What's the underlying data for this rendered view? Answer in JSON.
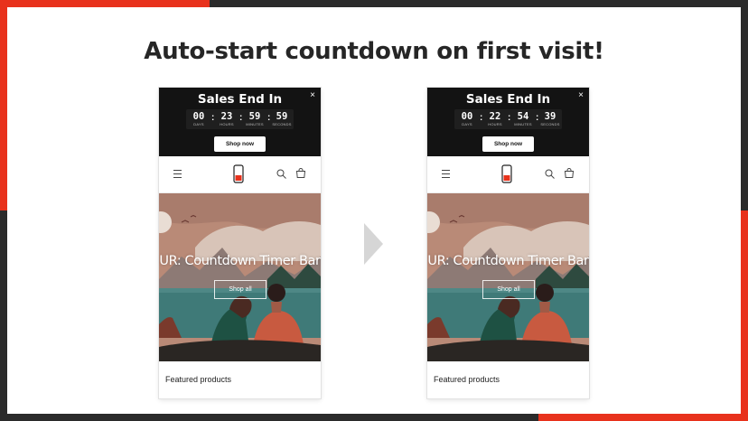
{
  "headline": "Auto-start countdown on first visit!",
  "phones": [
    {
      "announcement": {
        "title": "Sales End In",
        "close": "×",
        "timer": {
          "days": "00",
          "hours": "23",
          "minutes": "59",
          "seconds": "59",
          "days_label": "DAYS",
          "hours_label": "HOURS",
          "minutes_label": "MINUTES",
          "seconds_label": "SECONDS",
          "separator": ":"
        },
        "button": "Shop now"
      },
      "hero": {
        "heading": "UR: Countdown Timer Bar",
        "button": "Shop all"
      },
      "featured": "Featured products"
    },
    {
      "announcement": {
        "title": "Sales End In",
        "close": "×",
        "timer": {
          "days": "00",
          "hours": "22",
          "minutes": "54",
          "seconds": "39",
          "days_label": "DAYS",
          "hours_label": "HOURS",
          "minutes_label": "MINUTES",
          "seconds_label": "SECONDS",
          "separator": ":"
        },
        "button": "Shop now"
      },
      "hero": {
        "heading": "UR: Countdown Timer Bar",
        "button": "Shop all"
      },
      "featured": "Featured products"
    }
  ],
  "icons": [
    "menu-icon",
    "phone-logo-icon",
    "search-icon",
    "cart-icon",
    "close-icon",
    "arrow-right-icon"
  ],
  "colors": {
    "accent_red": "#e8321c",
    "frame_dark": "#2b2b2b",
    "bar_black": "#131313",
    "water": "#3f7a78",
    "sky": "#b98a77"
  }
}
